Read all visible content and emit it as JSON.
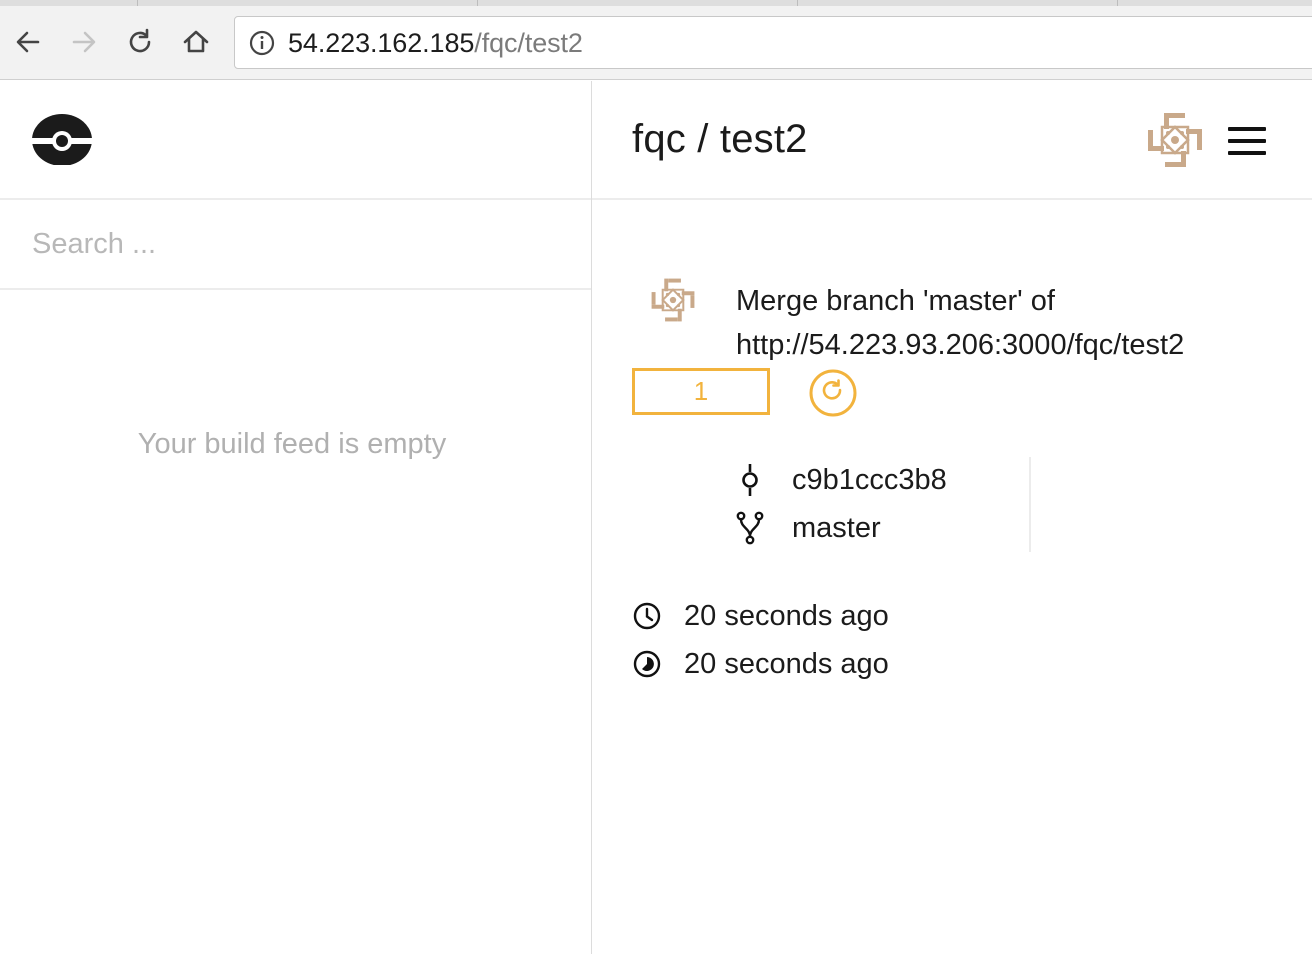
{
  "browser": {
    "url_host": "54.223.162.185",
    "url_path": "/fqc/test2",
    "icons": {
      "back": "back-arrow-icon",
      "forward": "forward-arrow-icon",
      "reload": "reload-icon",
      "home": "home-icon",
      "info": "info-icon"
    }
  },
  "sidebar": {
    "search_placeholder": "Search ...",
    "empty_message": "Your build feed is empty"
  },
  "header": {
    "title": "fqc / test2"
  },
  "build": {
    "commit_message": "Merge branch 'master' of http://54.223.93.206:3000/fqc/test2",
    "number": "1",
    "commit_sha": "c9b1ccc3b8",
    "branch": "master",
    "started": "20 seconds ago",
    "duration": "20 seconds ago",
    "status_color": "#f2b33d"
  }
}
